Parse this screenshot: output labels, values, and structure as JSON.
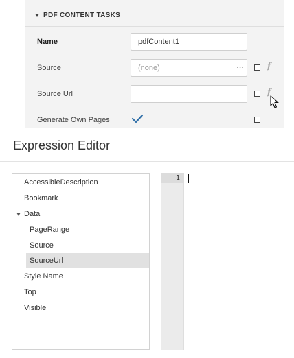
{
  "properties_panel": {
    "section_title": "PDF CONTENT TASKS",
    "rows": {
      "name": {
        "label": "Name",
        "value": "pdfContent1"
      },
      "source": {
        "label": "Source",
        "placeholder": "(none)",
        "ellipsis": "···"
      },
      "source_url": {
        "label": "Source Url",
        "value": ""
      },
      "generate_own_pages": {
        "label": "Generate Own Pages",
        "checked": true
      }
    },
    "fx_glyph": "f"
  },
  "expression_editor": {
    "title": "Expression Editor",
    "tree": {
      "items": [
        {
          "label": "AccessibleDescription",
          "level": 0
        },
        {
          "label": "Bookmark",
          "level": 0
        },
        {
          "label": "Data",
          "level": 0,
          "expanded": true
        },
        {
          "label": "PageRange",
          "level": 1
        },
        {
          "label": "Source",
          "level": 1
        },
        {
          "label": "SourceUrl",
          "level": 1,
          "selected": true
        },
        {
          "label": "Style Name",
          "level": 0
        },
        {
          "label": "Top",
          "level": 0
        },
        {
          "label": "Visible",
          "level": 0
        }
      ]
    },
    "code": {
      "line_number": "1",
      "text": ""
    }
  },
  "colors": {
    "panel_bg": "#f3f3f3",
    "selection_bg": "#e1e1e1",
    "checkmark": "#2f6fa8",
    "gutter_bg": "#ebebeb"
  }
}
